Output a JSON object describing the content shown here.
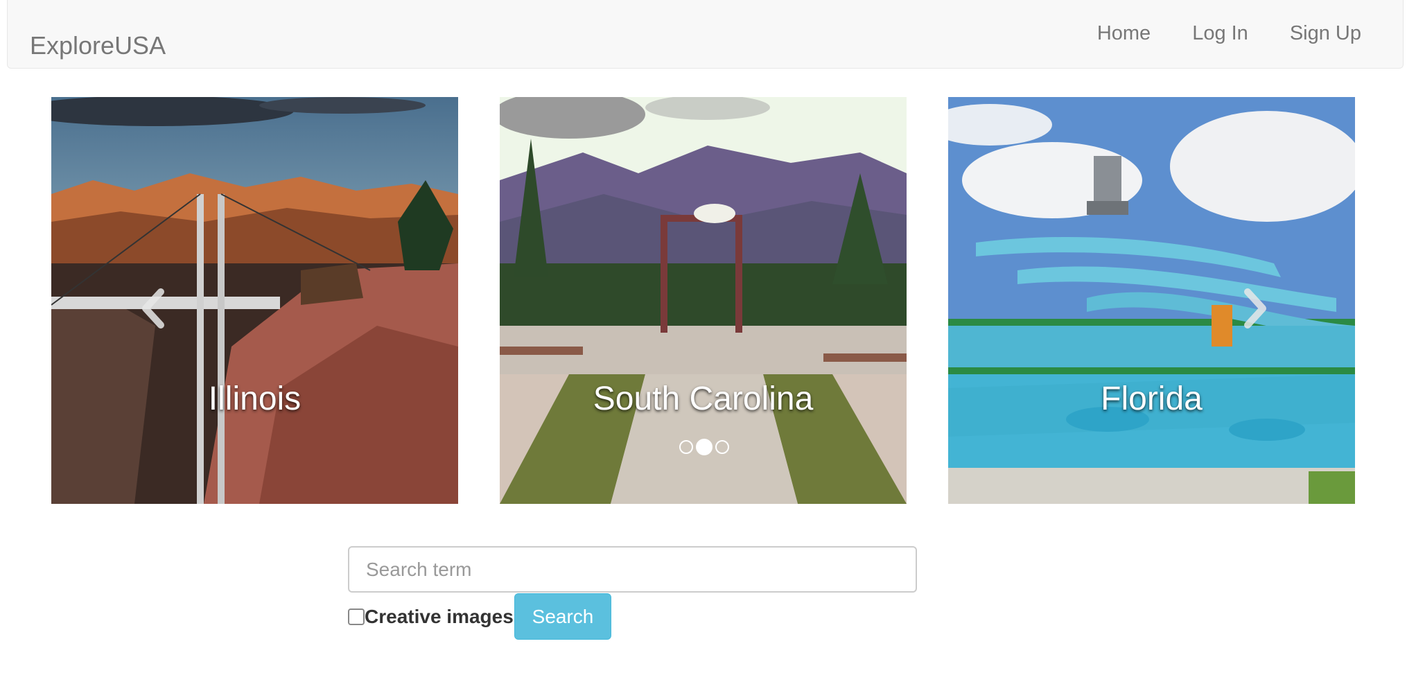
{
  "navbar": {
    "brand": "ExploreUSA",
    "links": [
      "Home",
      "Log In",
      "Sign Up"
    ]
  },
  "carousel": {
    "slides": [
      {
        "caption": "Illinois"
      },
      {
        "caption": "South Carolina"
      },
      {
        "caption": "Florida"
      }
    ],
    "active_index": 1,
    "indicator_count": 3,
    "prev_icon": "chevron-left-icon",
    "next_icon": "chevron-right-icon"
  },
  "search": {
    "placeholder": "Search term",
    "value": "",
    "checkbox_label": "Creative images",
    "checkbox_checked": false,
    "button_label": "Search"
  },
  "colors": {
    "navbar_bg": "#f8f8f8",
    "nav_text": "#777777",
    "button_bg": "#5bc0de"
  }
}
